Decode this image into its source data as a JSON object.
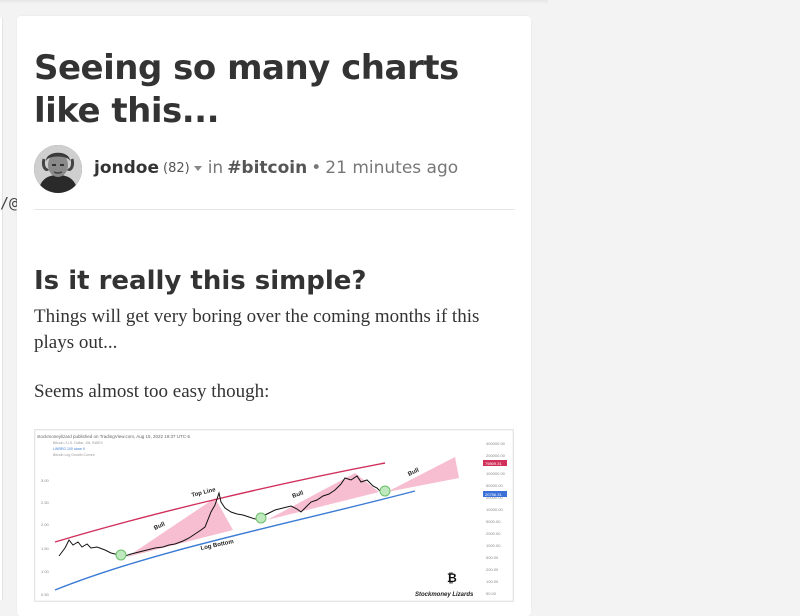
{
  "left_panel": {
    "text": "/@"
  },
  "post": {
    "title": "Seeing so many charts like this...",
    "author": {
      "name": "jondoe",
      "reputation": "(82)"
    },
    "in_label": "in",
    "community": "#bitcoin",
    "separator": "•",
    "time_ago": "21 minutes ago",
    "heading": "Is it really this simple?",
    "paragraphs": [
      "Things will get very boring over the coming months if this plays out...",
      "Seems almost too easy though:"
    ]
  },
  "embedded_chart": {
    "header_line": "stockmoneylizard published on TradingView.com, Aug 15, 2022 19:37 UTC-5",
    "labels": {
      "top_line": "Top Line",
      "log_bottom": "Log Bottom",
      "bull": "Bull",
      "brand": "Stockmoney Lizards",
      "price_tag_top": "79809.31",
      "price_tag_bottom": "20756.31"
    },
    "y_ticks": [
      "400000.00",
      "200000.00",
      "100000.00",
      "50000.00",
      "20000.00",
      "10000.00",
      "5000.00",
      "2000.00",
      "1000.00",
      "500.00",
      "200.00",
      "100.00",
      "50.00",
      "22.00"
    ],
    "left_ticks": [
      "3.00",
      "2.50",
      "2.00",
      "1.50",
      "1.00",
      "0.50"
    ],
    "colors": {
      "top_line": "#d0305a",
      "log_bottom": "#3a7bd5",
      "bull_band": "#f4a7c0",
      "price": "#111111",
      "touch": "#7ed07e"
    }
  }
}
